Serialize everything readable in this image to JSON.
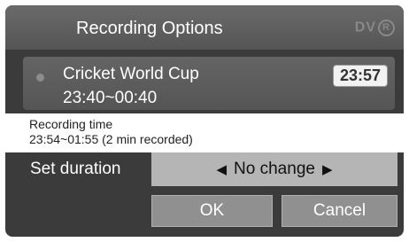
{
  "dialog": {
    "title": "Recording Options",
    "logo_text": "DV",
    "logo_ring_letter": "R"
  },
  "recording": {
    "program_name": "Cricket World Cup",
    "time_range": "23:40~00:40",
    "current_time": "23:57",
    "status_dot_color": "#8c8c8c"
  },
  "info": {
    "label": "Recording time",
    "value": "23:54~01:55  (2 min recorded)"
  },
  "duration": {
    "label": "Set duration",
    "value": "No change",
    "left_arrow": "◀",
    "right_arrow": "▶"
  },
  "buttons": {
    "ok": "OK",
    "cancel": "Cancel"
  }
}
